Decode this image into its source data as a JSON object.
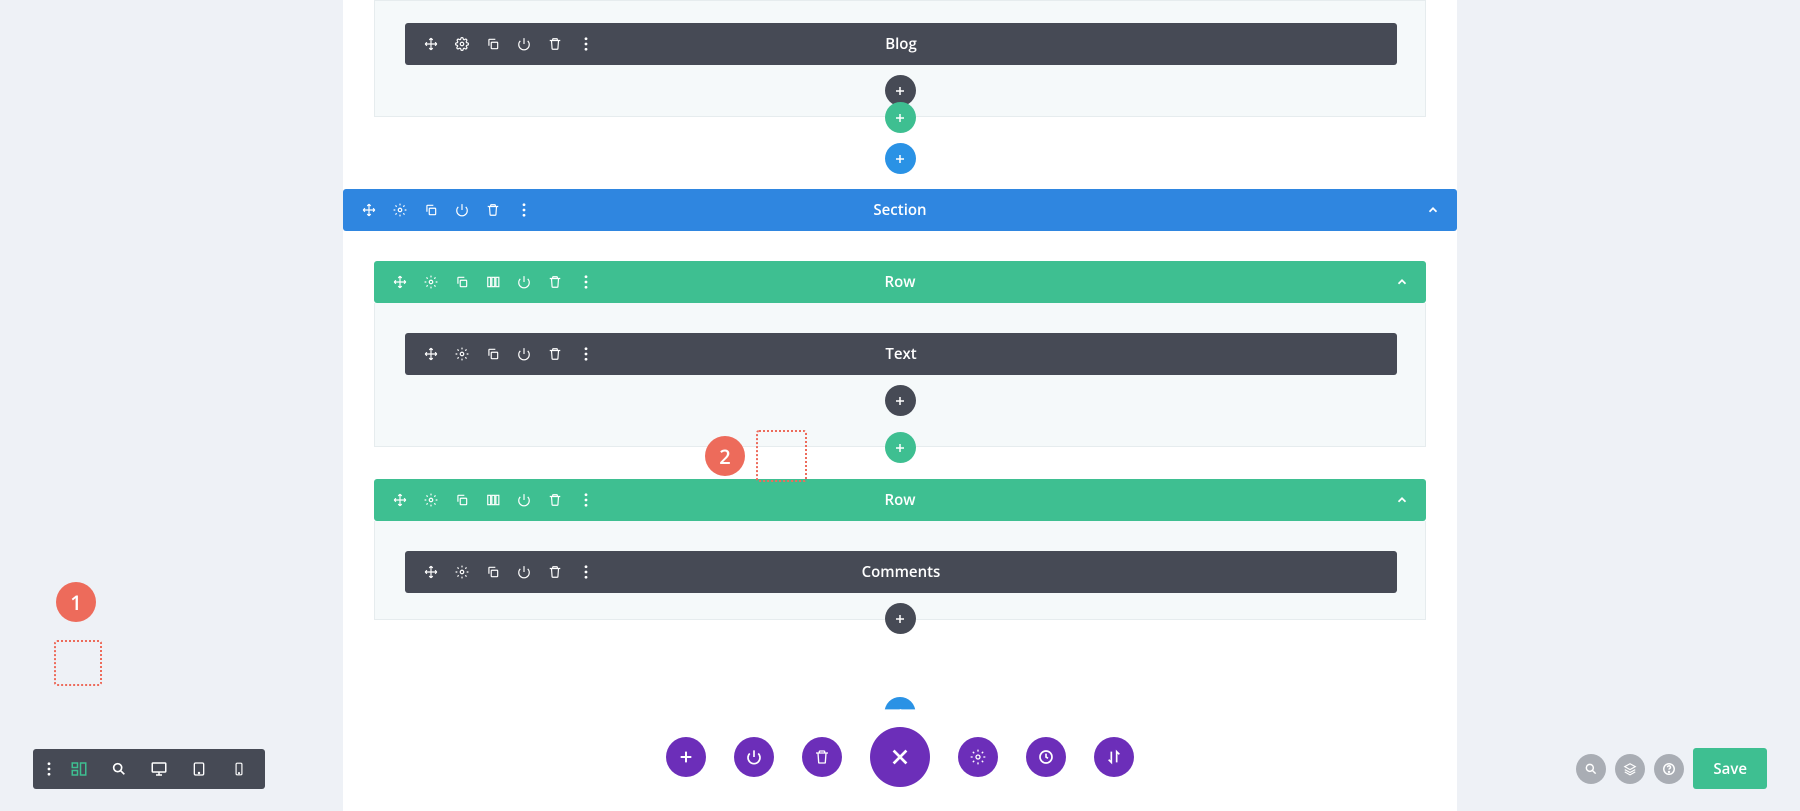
{
  "modules": {
    "blog": "Blog",
    "text": "Text",
    "comments": "Comments"
  },
  "section_label": "Section",
  "row_label": "Row",
  "bottom": {
    "save": "Save"
  },
  "annotations": {
    "one": "1",
    "two": "2"
  },
  "colors": {
    "section": "#2f86e0",
    "row": "#3ebf91",
    "module": "#464a55",
    "purple": "#6c2eb9",
    "annotation": "#ed6b5b"
  }
}
